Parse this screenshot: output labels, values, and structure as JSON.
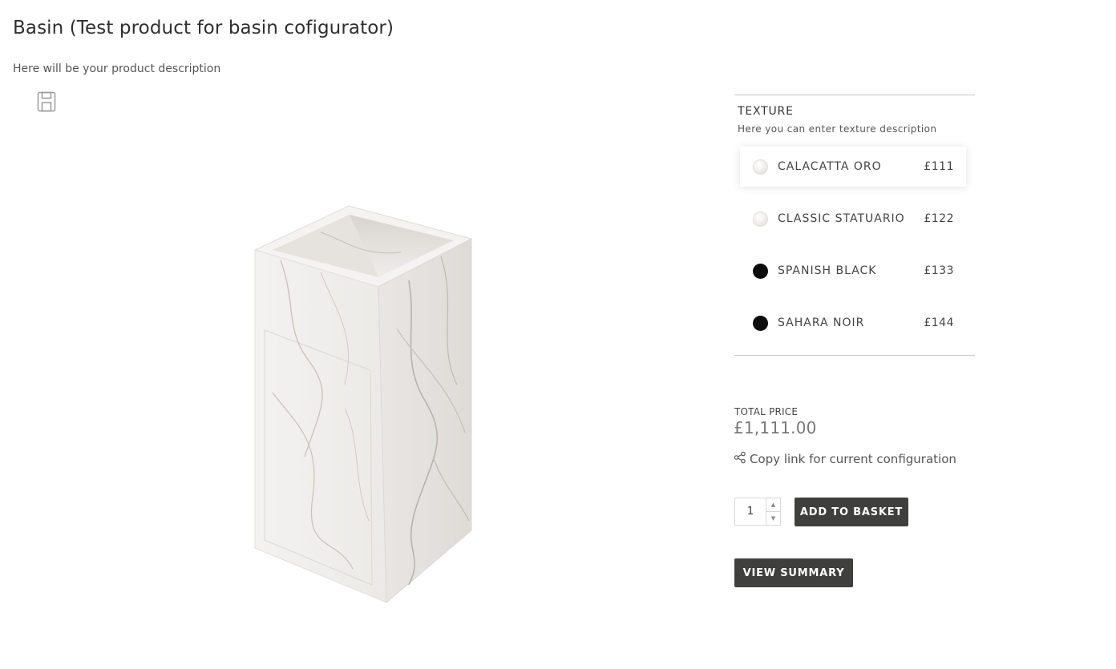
{
  "product": {
    "title": "Basin (Test product for basin cofigurator)",
    "description": "Here will be your product description"
  },
  "icons": {
    "save": "save-icon",
    "share": "share-icon"
  },
  "texture": {
    "heading": "TEXTURE",
    "description": "Here you can enter texture description",
    "options": [
      {
        "label": "CALACATTA ORO",
        "price": "£111",
        "swatch": "marble",
        "selected": true
      },
      {
        "label": "CLASSIC STATUARIO",
        "price": "£122",
        "swatch": "marble",
        "selected": false
      },
      {
        "label": "SPANISH BLACK",
        "price": "£133",
        "swatch": "#0d0d0d",
        "selected": false
      },
      {
        "label": "SAHARA NOIR",
        "price": "£144",
        "swatch": "#0d0d0d",
        "selected": false
      }
    ]
  },
  "pricing": {
    "total_label": "TOTAL PRICE",
    "total_value": "£1,111.00"
  },
  "actions": {
    "copy_link": "Copy link for current configuration",
    "quantity": "1",
    "add_to_basket": "ADD TO BASKET",
    "view_summary": "VIEW SUMMARY"
  },
  "colors": {
    "button_bg": "#3f3f3d",
    "divider": "#c8c8c8"
  }
}
